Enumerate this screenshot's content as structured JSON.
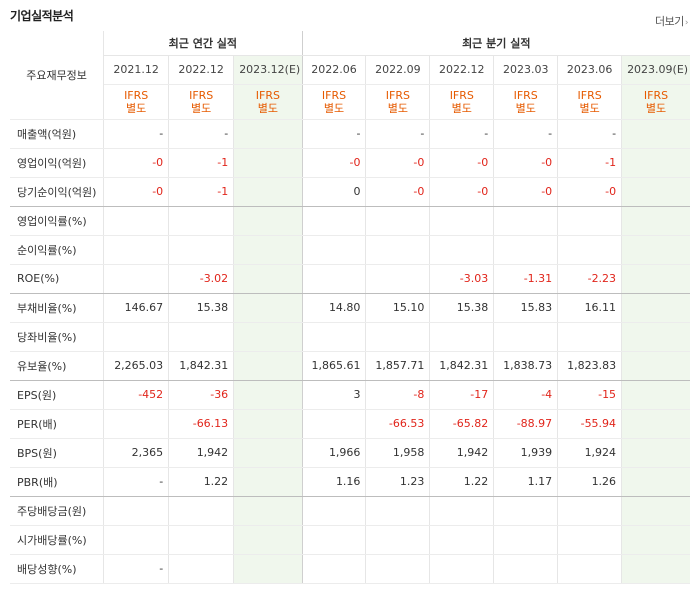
{
  "header": {
    "title": "기업실적분석",
    "more_label": "더보기"
  },
  "table": {
    "row_header": "주요재무정보",
    "groups": {
      "annual": "최근 연간 실적",
      "quarterly": "최근 분기 실적"
    },
    "columns": [
      {
        "date": "2021.12",
        "ifrs": [
          "IFRS",
          "별도"
        ]
      },
      {
        "date": "2022.12",
        "ifrs": [
          "IFRS",
          "별도"
        ]
      },
      {
        "date": "2023.12(E)",
        "ifrs": [
          "IFRS",
          "별도"
        ]
      },
      {
        "date": "2022.06",
        "ifrs": [
          "IFRS",
          "별도"
        ]
      },
      {
        "date": "2022.09",
        "ifrs": [
          "IFRS",
          "별도"
        ]
      },
      {
        "date": "2022.12",
        "ifrs": [
          "IFRS",
          "별도"
        ]
      },
      {
        "date": "2023.03",
        "ifrs": [
          "IFRS",
          "별도"
        ]
      },
      {
        "date": "2023.06",
        "ifrs": [
          "IFRS",
          "별도"
        ]
      },
      {
        "date": "2023.09(E)",
        "ifrs": [
          "IFRS",
          "별도"
        ]
      }
    ],
    "rows": [
      {
        "label": "매출액(억원)",
        "values": [
          "-",
          "-",
          "",
          "-",
          "-",
          "-",
          "-",
          "-",
          ""
        ]
      },
      {
        "label": "영업이익(억원)",
        "values": [
          "-0",
          "-1",
          "",
          "-0",
          "-0",
          "-0",
          "-0",
          "-1",
          ""
        ]
      },
      {
        "label": "당기순이익(억원)",
        "values": [
          "-0",
          "-1",
          "",
          "0",
          "-0",
          "-0",
          "-0",
          "-0",
          ""
        ]
      },
      {
        "label": "영업이익률(%)",
        "values": [
          "",
          "",
          "",
          "",
          "",
          "",
          "",
          "",
          ""
        ]
      },
      {
        "label": "순이익률(%)",
        "values": [
          "",
          "",
          "",
          "",
          "",
          "",
          "",
          "",
          ""
        ]
      },
      {
        "label": "ROE(%)",
        "values": [
          "",
          "-3.02",
          "",
          "",
          "",
          "-3.03",
          "-1.31",
          "-2.23",
          ""
        ]
      },
      {
        "label": "부채비율(%)",
        "values": [
          "146.67",
          "15.38",
          "",
          "14.80",
          "15.10",
          "15.38",
          "15.83",
          "16.11",
          ""
        ]
      },
      {
        "label": "당좌비율(%)",
        "values": [
          "",
          "",
          "",
          "",
          "",
          "",
          "",
          "",
          ""
        ]
      },
      {
        "label": "유보율(%)",
        "values": [
          "2,265.03",
          "1,842.31",
          "",
          "1,865.61",
          "1,857.71",
          "1,842.31",
          "1,838.73",
          "1,823.83",
          ""
        ]
      },
      {
        "label": "EPS(원)",
        "values": [
          "-452",
          "-36",
          "",
          "3",
          "-8",
          "-17",
          "-4",
          "-15",
          ""
        ]
      },
      {
        "label": "PER(배)",
        "values": [
          "",
          "-66.13",
          "",
          "",
          "-66.53",
          "-65.82",
          "-88.97",
          "-55.94",
          ""
        ]
      },
      {
        "label": "BPS(원)",
        "values": [
          "2,365",
          "1,942",
          "",
          "1,966",
          "1,958",
          "1,942",
          "1,939",
          "1,924",
          ""
        ]
      },
      {
        "label": "PBR(배)",
        "values": [
          "-",
          "1.22",
          "",
          "1.16",
          "1.23",
          "1.22",
          "1.17",
          "1.26",
          ""
        ]
      },
      {
        "label": "주당배당금(원)",
        "values": [
          "",
          "",
          "",
          "",
          "",
          "",
          "",
          "",
          ""
        ]
      },
      {
        "label": "시가배당률(%)",
        "values": [
          "",
          "",
          "",
          "",
          "",
          "",
          "",
          "",
          ""
        ]
      },
      {
        "label": "배당성향(%)",
        "values": [
          "-",
          "",
          "",
          "",
          "",
          "",
          "",
          "",
          ""
        ]
      }
    ]
  },
  "colors": {
    "negative": "#e1251b",
    "ifrs": "#e65a00",
    "estimate_bg": "#f0f7ed"
  }
}
